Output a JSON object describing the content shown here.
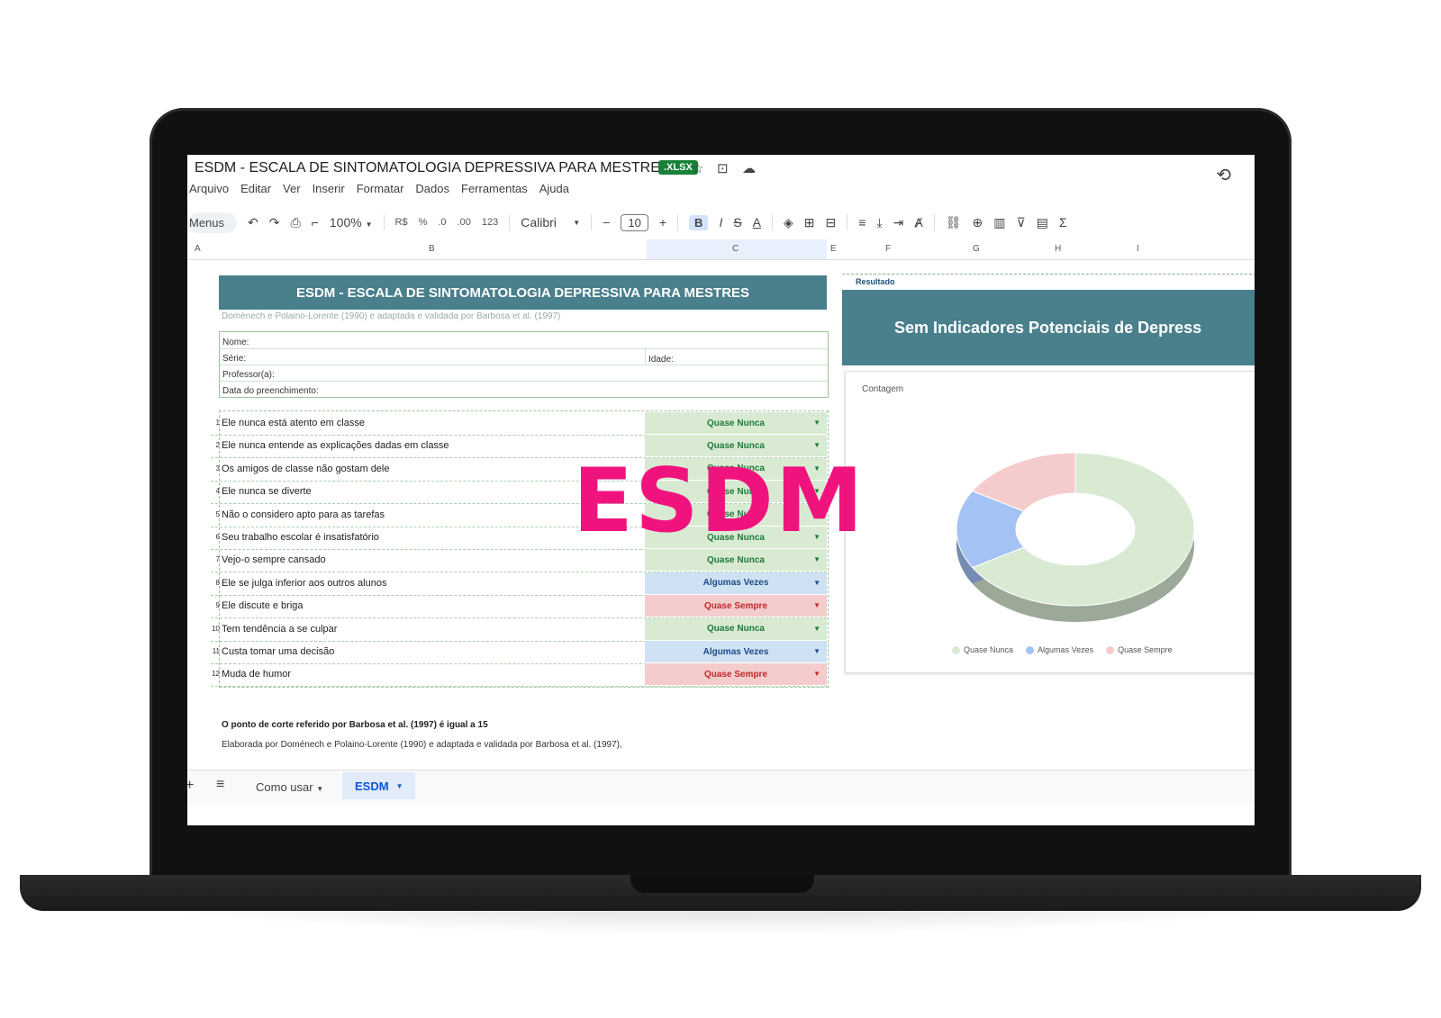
{
  "app": {
    "doc_title": "ESDM - ESCALA DE SINTOMATOLOGIA DEPRESSIVA PARA MESTRES",
    "file_badge": ".XLSX",
    "menu": [
      "Arquivo",
      "Editar",
      "Ver",
      "Inserir",
      "Formatar",
      "Dados",
      "Ferramentas",
      "Ajuda"
    ]
  },
  "toolbar": {
    "menus_label": "Menus",
    "zoom": "100%",
    "currency": "R$",
    "percent": "%",
    "dec_less": ".0",
    "dec_more": ".00",
    "number_format": "123",
    "font": "Calibri",
    "font_size": "10",
    "bold": "B",
    "italic": "I",
    "strike": "S",
    "text_color": "A"
  },
  "columns": [
    "A",
    "B",
    "C",
    "E",
    "F",
    "G",
    "H",
    "I"
  ],
  "sheet": {
    "title": "ESDM - ESCALA DE SINTOMATOLOGIA DEPRESSIVA PARA MESTRES",
    "subtitle": "Doménech e Polaino-Lorente (1990) e adaptada e validada por Barbosa et al. (1997)",
    "form": {
      "nome": "Nome:",
      "serie": "Série:",
      "idade": "Idade:",
      "professor": "Professor(a):",
      "data": "Data do preenchimento:"
    },
    "questions": [
      {
        "num": "1",
        "text": "Ele nunca está atento em classe",
        "answer": "Quase Nunca"
      },
      {
        "num": "2",
        "text": "Ele nunca entende as explicações dadas em classe",
        "answer": "Quase Nunca"
      },
      {
        "num": "3",
        "text": "Os amigos de classe não gostam dele",
        "answer": "Quase Nunca"
      },
      {
        "num": "4",
        "text": "Ele nunca se diverte",
        "answer": "Quase Nunca"
      },
      {
        "num": "5",
        "text": "Não o considero apto para as tarefas",
        "answer": "Quase Nunca"
      },
      {
        "num": "6",
        "text": "Seu trabalho escolar é insatisfatório",
        "answer": "Quase Nunca"
      },
      {
        "num": "7",
        "text": "Vejo-o sempre cansado",
        "answer": "Quase Nunca"
      },
      {
        "num": "8",
        "text": "Ele se julga inferior aos outros alunos",
        "answer": "Algumas Vezes"
      },
      {
        "num": "9",
        "text": "Ele discute e briga",
        "answer": "Quase Sempre"
      },
      {
        "num": "10",
        "text": "Tem tendência a se culpar",
        "answer": "Quase Nunca"
      },
      {
        "num": "11",
        "text": "Custa tomar uma decisão",
        "answer": "Algumas Vezes"
      },
      {
        "num": "12",
        "text": "Muda de humor",
        "answer": "Quase Sempre"
      }
    ],
    "note_bold": "O ponto de corte referido por Barbosa et al. (1997) é igual a 15",
    "note_text": "Elaborada por Doménech e Polaino-Lorente (1990) e adaptada e validada por Barbosa et al. (1997),"
  },
  "result": {
    "label": "Resultado",
    "text": "Sem Indicadores Potenciais de Depress"
  },
  "chart_data": {
    "type": "pie",
    "title": "Contagem",
    "categories": [
      "Quase Nunca",
      "Algumas Vezes",
      "Quase Sempre"
    ],
    "values": [
      8,
      2,
      2
    ],
    "colors": [
      "#d9ead3",
      "#a4c2f4",
      "#f4cccc"
    ],
    "legend": "bottom"
  },
  "tabs": {
    "como_usar": "Como usar",
    "esdm": "ESDM"
  },
  "watermark": "ESDM",
  "colors": {
    "header_teal": "#4a7f8c",
    "watermark": "#f0137e"
  }
}
